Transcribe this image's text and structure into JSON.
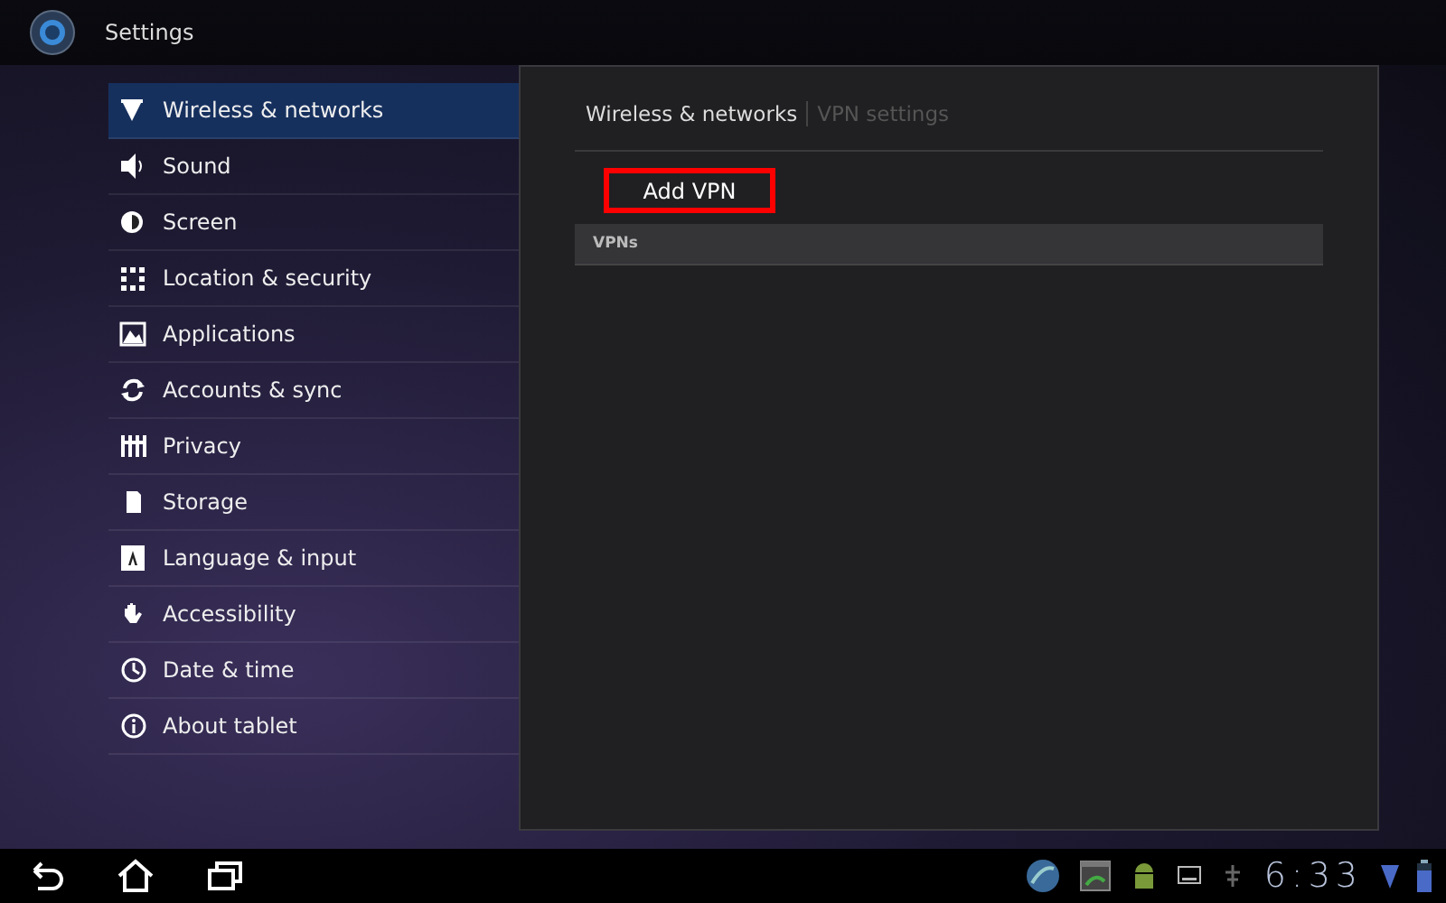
{
  "app_bar": {
    "title": "Settings"
  },
  "sidebar": {
    "items": [
      {
        "label": "Wireless & networks",
        "selected": true
      },
      {
        "label": "Sound",
        "selected": false
      },
      {
        "label": "Screen",
        "selected": false
      },
      {
        "label": "Location & security",
        "selected": false
      },
      {
        "label": "Applications",
        "selected": false
      },
      {
        "label": "Accounts & sync",
        "selected": false
      },
      {
        "label": "Privacy",
        "selected": false
      },
      {
        "label": "Storage",
        "selected": false
      },
      {
        "label": "Language & input",
        "selected": false
      },
      {
        "label": "Accessibility",
        "selected": false
      },
      {
        "label": "Date & time",
        "selected": false
      },
      {
        "label": "About tablet",
        "selected": false
      }
    ]
  },
  "panel": {
    "breadcrumbs": [
      {
        "label": "Wireless & networks",
        "dimmed": false
      },
      {
        "label": "VPN settings",
        "dimmed": true
      }
    ],
    "add_button": {
      "label": "Add VPN",
      "highlighted": true
    },
    "section_header": "VPNs"
  },
  "system_bar": {
    "clock": "6:33"
  }
}
